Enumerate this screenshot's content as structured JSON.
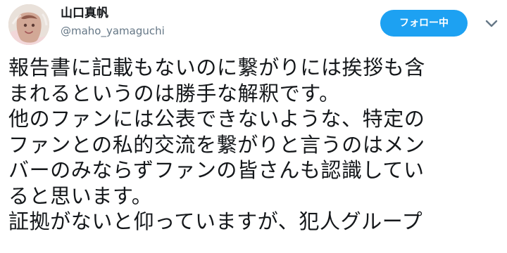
{
  "user": {
    "display_name": "山口真帆",
    "handle": "@maho_yamaguchi"
  },
  "follow_button": {
    "label": "フォロー中"
  },
  "more_button": {
    "icon": "chevron-down-icon"
  },
  "tweet": {
    "lines": [
      "報告書に記載もないのに繋がりには挨拶も含",
      "まれるというのは勝手な解釈です。",
      "他のファンには公表できないような、特定の",
      "ファンとの私的交流を繋がりと言うのはメン",
      "バーのみならずファンの皆さんも認識してい",
      "ると思います。",
      "証拠がないと仰っていますが、犯人グループ"
    ]
  },
  "colors": {
    "accent": "#1da1f2",
    "text": "#14171a",
    "secondary_text": "#657786"
  }
}
